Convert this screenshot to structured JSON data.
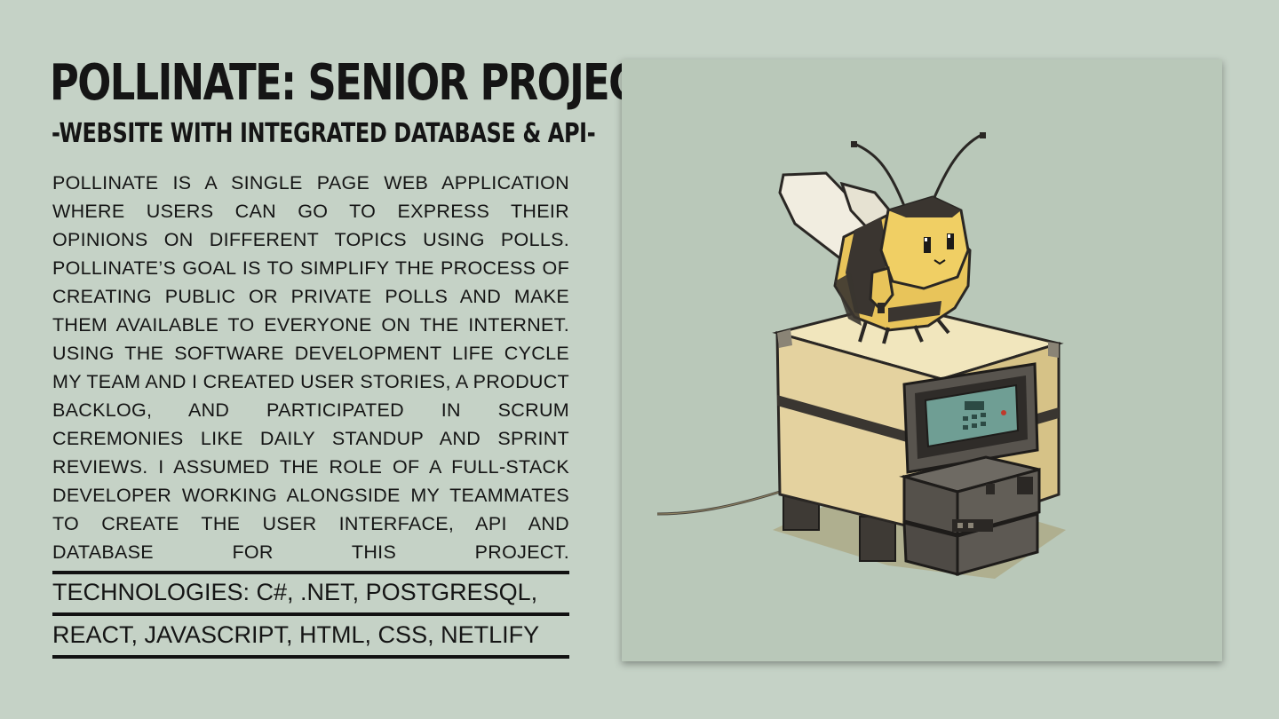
{
  "header": {
    "title": "POLLINATE: SENIOR PROJECT",
    "subtitle": "-WEBSITE WITH INTEGRATED DATABASE & API-"
  },
  "description": "POLLINATE IS A SINGLE PAGE WEB APPLICATION WHERE USERS CAN GO TO EXPRESS THEIR OPINIONS ON DIFFERENT TOPICS USING POLLS. POLLINATE’S GOAL IS TO SIMPLIFY THE PROCESS OF CREATING PUBLIC OR PRIVATE POLLS AND MAKE THEM AVAILABLE TO EVERYONE ON THE INTERNET. USING THE SOFTWARE DEVELOPMENT LIFE CYCLE MY TEAM AND I CREATED USER STORIES, A PRODUCT BACKLOG, AND PARTICIPATED IN SCRUM CEREMONIES LIKE DAILY STANDUP AND SPRINT REVIEWS. I ASSUMED THE ROLE OF A FULL-STACK DEVELOPER WORKING ALONGSIDE MY TEAMMATES TO CREATE THE USER INTERFACE, API AND DATABASE FOR THIS PROJECT.",
  "technologies": {
    "line1": "TECHNOLOGIES: C#, .NET, POSTGRESQL,",
    "line2": "REACT, JAVASCRIPT, HTML, CSS, NETLIFY"
  },
  "artwork": {
    "icon": "bee-on-computer-illustration",
    "colors": {
      "background": "#c5d2c6",
      "panel": "#b9c8b9",
      "bee_yellow": "#e8c45a",
      "bee_dark": "#3a3530",
      "box_cream": "#e9dcaf",
      "device_gray": "#5e5a55",
      "screen_teal": "#6f9e94"
    }
  }
}
